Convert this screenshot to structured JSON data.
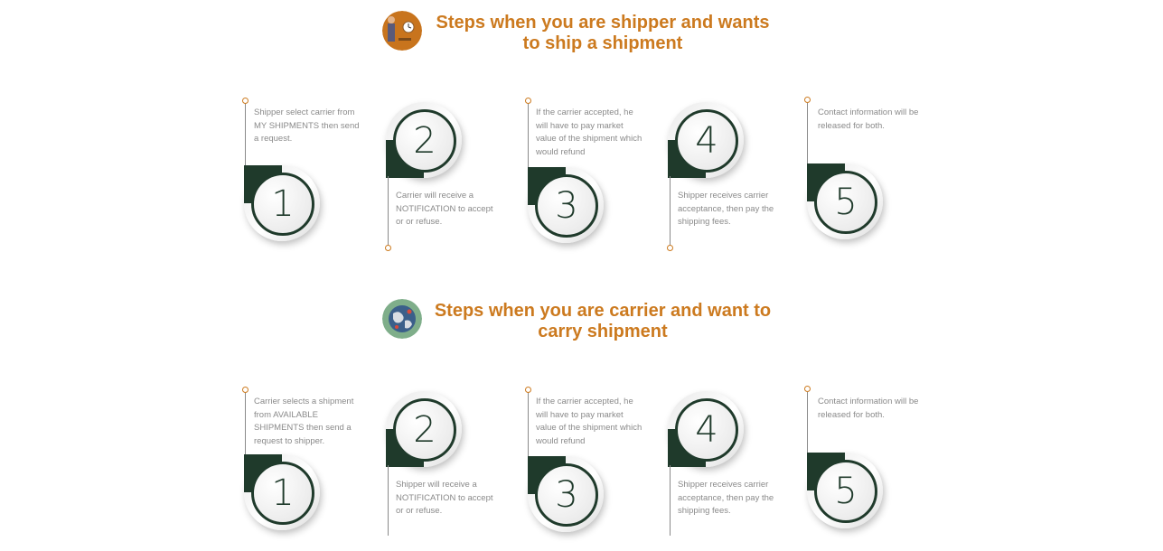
{
  "sections": [
    {
      "title": "Steps when you are shipper and wants to ship a shipment",
      "icon": "shipper-clock-icon",
      "steps": [
        {
          "number": "1",
          "text": "Shipper select carrier from MY SHIPMENTS then send a request."
        },
        {
          "number": "2",
          "text": "Carrier will receive a NOTIFICATION to accept or or refuse."
        },
        {
          "number": "3",
          "text": "If the carrier accepted, he will have to pay market value of the shipment which would refund"
        },
        {
          "number": "4",
          "text": "Shipper receives carrier acceptance, then pay the shipping fees."
        },
        {
          "number": "5",
          "text": "Contact information will be released for both."
        }
      ]
    },
    {
      "title": "Steps when you are carrier and want to carry shipment",
      "icon": "globe-route-icon",
      "steps": [
        {
          "number": "1",
          "text": "Carrier selects a shipment from AVAILABLE SHIPMENTS then send a request to shipper."
        },
        {
          "number": "2",
          "text": "Shipper will receive a NOTIFICATION to accept or or refuse."
        },
        {
          "number": "3",
          "text": "If the carrier accepted, he will have to pay market value of the shipment which would refund"
        },
        {
          "number": "4",
          "text": "Shipper receives carrier acceptance, then pay the shipping fees."
        },
        {
          "number": "5",
          "text": "Contact information will be released for both."
        }
      ]
    }
  ],
  "colors": {
    "accent": "#cc7a1f",
    "dark": "#1f3a2b",
    "text": "#8a8a8a"
  }
}
